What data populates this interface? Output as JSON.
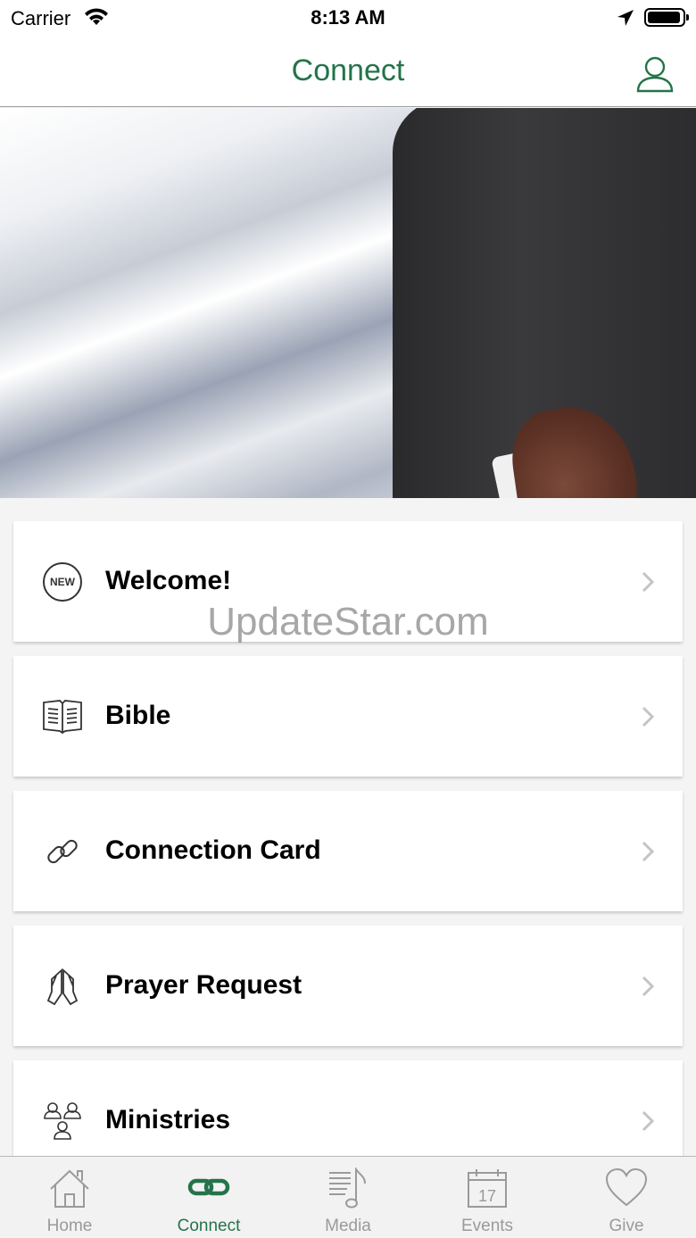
{
  "status_bar": {
    "carrier": "Carrier",
    "time": "8:13 AM"
  },
  "nav": {
    "title": "Connect",
    "title_color": "#24734a",
    "profile_icon": "person-icon"
  },
  "hero": {
    "description_icon": "handshake-photo"
  },
  "list": {
    "items": [
      {
        "label": "Welcome!",
        "icon": "new-badge-icon",
        "icon_text": "NEW"
      },
      {
        "label": "Bible",
        "icon": "book-icon"
      },
      {
        "label": "Connection Card",
        "icon": "link-icon"
      },
      {
        "label": "Prayer Request",
        "icon": "praying-hands-icon"
      },
      {
        "label": "Ministries",
        "icon": "people-icon"
      }
    ]
  },
  "watermark": "UpdateStar.com",
  "tab_bar": {
    "active_color": "#24734a",
    "inactive_color": "#9a9a9a",
    "tabs": [
      {
        "label": "Home",
        "icon": "home-icon",
        "active": false
      },
      {
        "label": "Connect",
        "icon": "link-icon",
        "active": true
      },
      {
        "label": "Media",
        "icon": "music-note-icon",
        "active": false
      },
      {
        "label": "Events",
        "icon": "calendar-icon",
        "active": false,
        "icon_text": "17"
      },
      {
        "label": "Give",
        "icon": "heart-icon",
        "active": false
      }
    ]
  }
}
